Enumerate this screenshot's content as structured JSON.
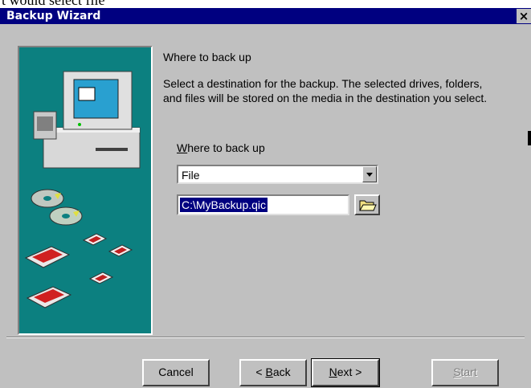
{
  "caption": "t would select file",
  "window": {
    "title": "Backup Wizard",
    "close_glyph": "×"
  },
  "page": {
    "heading": "Where to back up",
    "description": "Select a destination for the backup.  The selected drives, folders, and files will be stored on the media in the destination you select.",
    "field_label_mnemonic": "W",
    "field_label_rest": "here to back up",
    "destination": {
      "selected": "File"
    },
    "path_value": "C:\\MyBackup.qic"
  },
  "buttons": {
    "cancel": "Cancel",
    "back_prefix": "< ",
    "back_mnemonic": "B",
    "back_rest": "ack",
    "next_mnemonic": "N",
    "next_rest": "ext >",
    "start_mnemonic": "S",
    "start_rest": "tart"
  },
  "icons": {
    "close": "close-icon",
    "dropdown": "chevron-down-icon",
    "browse": "open-folder-icon",
    "computer": "computer-illustration",
    "discs": "cd-disc-icon",
    "tapes": "tape-cartridge-icon"
  },
  "colors": {
    "titlebar": "#000080",
    "face": "#c0c0c0",
    "art_bg": "#0c8080",
    "selection": "#000080"
  }
}
